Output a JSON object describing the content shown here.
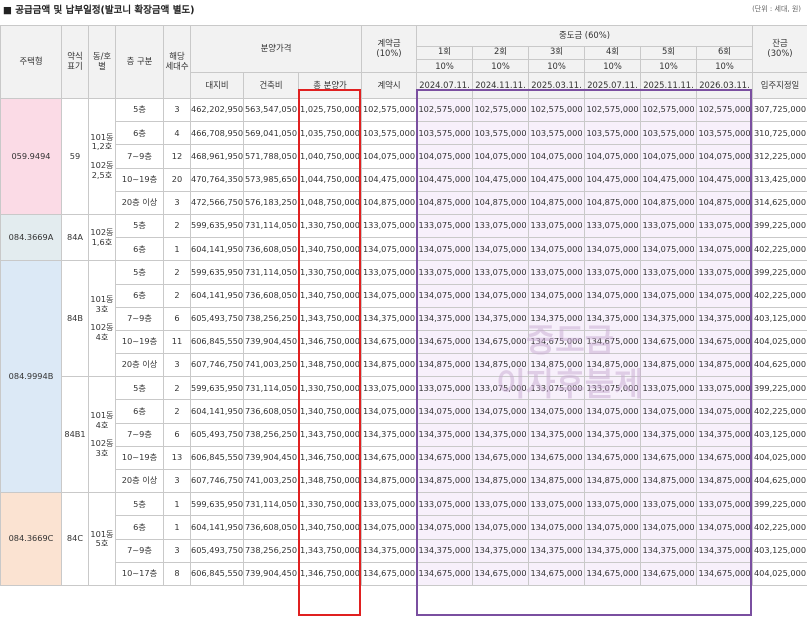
{
  "title": "■ 공급금액 및 납부일정(발코니 확장금액 별도)",
  "unit": "(단위 : 세대, 원)",
  "header": {
    "type": "주택형",
    "abbr": "약식\n표기",
    "dong": "동/호\n별",
    "floor": "층 구분",
    "units": "해당\n세대수",
    "price": "분양가격",
    "land": "대지비",
    "building": "건축비",
    "total": "총 분양가",
    "deposit": "계약금\n(10%)",
    "deposit_timing": "계약시",
    "middle": "중도금 (60%)",
    "rounds": [
      "1회",
      "2회",
      "3회",
      "4회",
      "5회",
      "6회"
    ],
    "round_pcts": [
      "10%",
      "10%",
      "10%",
      "10%",
      "10%",
      "10%"
    ],
    "round_dates": [
      "2024.07.11.",
      "2024.11.11.",
      "2025.03.11.",
      "2025.07.11.",
      "2025.11.11.",
      "2026.03.11."
    ],
    "balance": "잔금\n(30%)",
    "balance_timing": "입주지정일"
  },
  "groups": [
    {
      "type": "059.9494",
      "abbr": "59",
      "cls": "g59",
      "subgroups": [
        {
          "dong": "101동\n1,2호\n\n102동\n2,5호",
          "rows": [
            {
              "floor": "5층",
              "units": "3",
              "land": "462,202,950",
              "building": "563,547,050",
              "total": "1,025,750,000",
              "deposit": "102,575,000",
              "middle": "102,575,000",
              "balance": "307,725,000"
            },
            {
              "floor": "6층",
              "units": "4",
              "land": "466,708,950",
              "building": "569,041,050",
              "total": "1,035,750,000",
              "deposit": "103,575,000",
              "middle": "103,575,000",
              "balance": "310,725,000"
            },
            {
              "floor": "7~9층",
              "units": "12",
              "land": "468,961,950",
              "building": "571,788,050",
              "total": "1,040,750,000",
              "deposit": "104,075,000",
              "middle": "104,075,000",
              "balance": "312,225,000"
            },
            {
              "floor": "10~19층",
              "units": "20",
              "land": "470,764,350",
              "building": "573,985,650",
              "total": "1,044,750,000",
              "deposit": "104,475,000",
              "middle": "104,475,000",
              "balance": "313,425,000"
            },
            {
              "floor": "20층 이상",
              "units": "3",
              "land": "472,566,750",
              "building": "576,183,250",
              "total": "1,048,750,000",
              "deposit": "104,875,000",
              "middle": "104,875,000",
              "balance": "314,625,000"
            }
          ]
        }
      ]
    },
    {
      "type": "084.3669A",
      "abbr": "84A",
      "cls": "g84a",
      "subgroups": [
        {
          "dong": "102동\n1,6호",
          "rows": [
            {
              "floor": "5층",
              "units": "2",
              "land": "599,635,950",
              "building": "731,114,050",
              "total": "1,330,750,000",
              "deposit": "133,075,000",
              "middle": "133,075,000",
              "balance": "399,225,000"
            },
            {
              "floor": "6층",
              "units": "1",
              "land": "604,141,950",
              "building": "736,608,050",
              "total": "1,340,750,000",
              "deposit": "134,075,000",
              "middle": "134,075,000",
              "balance": "402,225,000"
            }
          ]
        }
      ]
    },
    {
      "type": "084.9994B",
      "abbr": "",
      "cls": "g84b",
      "subgroups": [
        {
          "abbr": "84B",
          "dong": "101동\n3호\n\n102동\n4호",
          "rows": [
            {
              "floor": "5층",
              "units": "2",
              "land": "599,635,950",
              "building": "731,114,050",
              "total": "1,330,750,000",
              "deposit": "133,075,000",
              "middle": "133,075,000",
              "balance": "399,225,000"
            },
            {
              "floor": "6층",
              "units": "2",
              "land": "604,141,950",
              "building": "736,608,050",
              "total": "1,340,750,000",
              "deposit": "134,075,000",
              "middle": "134,075,000",
              "balance": "402,225,000"
            },
            {
              "floor": "7~9층",
              "units": "6",
              "land": "605,493,750",
              "building": "738,256,250",
              "total": "1,343,750,000",
              "deposit": "134,375,000",
              "middle": "134,375,000",
              "balance": "403,125,000"
            },
            {
              "floor": "10~19층",
              "units": "11",
              "land": "606,845,550",
              "building": "739,904,450",
              "total": "1,346,750,000",
              "deposit": "134,675,000",
              "middle": "134,675,000",
              "balance": "404,025,000"
            },
            {
              "floor": "20층 이상",
              "units": "3",
              "land": "607,746,750",
              "building": "741,003,250",
              "total": "1,348,750,000",
              "deposit": "134,875,000",
              "middle": "134,875,000",
              "balance": "404,625,000"
            }
          ]
        },
        {
          "abbr": "84B1",
          "dong": "101동\n4호\n\n102동\n3호",
          "rows": [
            {
              "floor": "5층",
              "units": "2",
              "land": "599,635,950",
              "building": "731,114,050",
              "total": "1,330,750,000",
              "deposit": "133,075,000",
              "middle": "133,075,000",
              "balance": "399,225,000"
            },
            {
              "floor": "6층",
              "units": "2",
              "land": "604,141,950",
              "building": "736,608,050",
              "total": "1,340,750,000",
              "deposit": "134,075,000",
              "middle": "134,075,000",
              "balance": "402,225,000"
            },
            {
              "floor": "7~9층",
              "units": "6",
              "land": "605,493,750",
              "building": "738,256,250",
              "total": "1,343,750,000",
              "deposit": "134,375,000",
              "middle": "134,375,000",
              "balance": "403,125,000"
            },
            {
              "floor": "10~19층",
              "units": "13",
              "land": "606,845,550",
              "building": "739,904,450",
              "total": "1,346,750,000",
              "deposit": "134,675,000",
              "middle": "134,675,000",
              "balance": "404,025,000"
            },
            {
              "floor": "20층 이상",
              "units": "3",
              "land": "607,746,750",
              "building": "741,003,250",
              "total": "1,348,750,000",
              "deposit": "134,875,000",
              "middle": "134,875,000",
              "balance": "404,625,000"
            }
          ]
        }
      ]
    },
    {
      "type": "084.3669C",
      "abbr": "84C",
      "cls": "g84c",
      "subgroups": [
        {
          "dong": "101동\n5호",
          "rows": [
            {
              "floor": "5층",
              "units": "1",
              "land": "599,635,950",
              "building": "731,114,050",
              "total": "1,330,750,000",
              "deposit": "133,075,000",
              "middle": "133,075,000",
              "balance": "399,225,000"
            },
            {
              "floor": "6층",
              "units": "1",
              "land": "604,141,950",
              "building": "736,608,050",
              "total": "1,340,750,000",
              "deposit": "134,075,000",
              "middle": "134,075,000",
              "balance": "402,225,000"
            },
            {
              "floor": "7~9층",
              "units": "3",
              "land": "605,493,750",
              "building": "738,256,250",
              "total": "1,343,750,000",
              "deposit": "134,375,000",
              "middle": "134,375,000",
              "balance": "403,125,000"
            },
            {
              "floor": "10~17층",
              "units": "8",
              "land": "606,845,550",
              "building": "739,904,450",
              "total": "1,346,750,000",
              "deposit": "134,675,000",
              "middle": "134,675,000",
              "balance": "404,025,000"
            }
          ]
        }
      ]
    }
  ],
  "watermark": "중도금\n이자후불제",
  "colors": {
    "highlight_total": "#e02020",
    "highlight_middle": "#7a4fa0",
    "type59": "#fbdbe6",
    "type84A": "#e3ecef",
    "type84B": "#dce9f6",
    "type84C": "#fbe3d2"
  }
}
